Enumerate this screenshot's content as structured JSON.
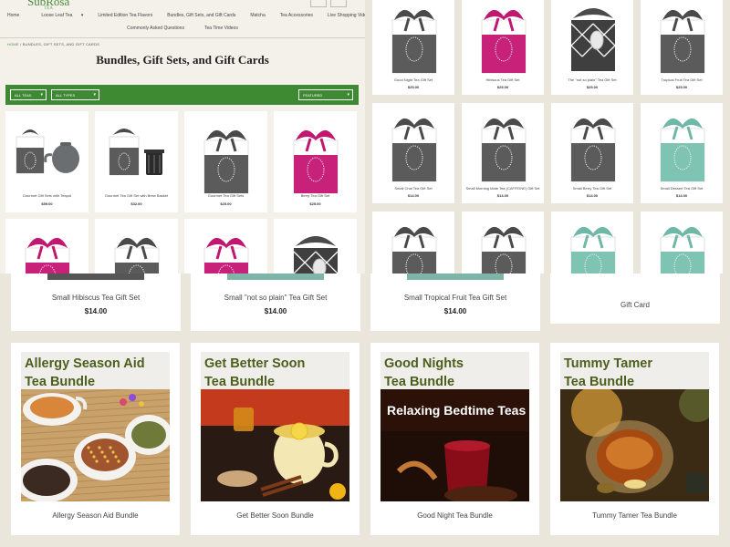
{
  "logo": {
    "text": "SubRosa",
    "sub": "TEA"
  },
  "nav": {
    "row1": [
      "Home",
      "Loose Leaf Tea",
      "Limited Edition Tea Flavors",
      "Bundles, Gift Sets, and Gift Cards",
      "Matcha",
      "Tea Accessories",
      "Live Shopping Videos"
    ],
    "row2": [
      "Commonly Asked Questions",
      "Tea Time Videos"
    ]
  },
  "breadcrumb": {
    "home": "HOME",
    "current": " / BUNDLES, GIFT SETS, AND GIFT CARDS"
  },
  "page_title": "Bundles, Gift Sets, and Gift Cards",
  "filters": {
    "teas": "ALL TEAS",
    "types": "ALL TYPES",
    "sort": "FEATURED"
  },
  "left_products": [
    {
      "name": "Gourmet Gift Sets with Teapot",
      "price": "$59.00",
      "art": "teapot"
    },
    {
      "name": "Gourmet Tea Gift Set with Brew Basket",
      "price": "$32.00",
      "art": "basket"
    },
    {
      "name": "Gourmet Tea Gift Sets",
      "price": "$25.00",
      "art": "gray"
    },
    {
      "name": "Berry Tea Gift Set",
      "price": "$25.00",
      "art": "pink"
    },
    {
      "name": "",
      "price": "",
      "art": "pink"
    },
    {
      "name": "",
      "price": "",
      "art": "gray"
    },
    {
      "name": "",
      "price": "",
      "art": "pink"
    },
    {
      "name": "",
      "price": "",
      "art": "pattern"
    }
  ],
  "right_products": [
    {
      "name": "Good Night Tea Gift Set",
      "price": "$25.00",
      "art": "gray"
    },
    {
      "name": "Hibiscus Tea Gift Set",
      "price": "$25.00",
      "art": "pink"
    },
    {
      "name": "The \"not so plain\" Tea Gift Set",
      "price": "$25.00",
      "art": "pattern"
    },
    {
      "name": "Tropical Fruit Tea Gift Set",
      "price": "$25.00",
      "art": "gray"
    },
    {
      "name": "Small Chai Tea Gift Set",
      "price": "$14.00",
      "art": "gray"
    },
    {
      "name": "Small Morning Mate Tea (CAFFEINE) Gift Set",
      "price": "$14.00",
      "art": "gray"
    },
    {
      "name": "Small Berry Tea Gift Set",
      "price": "$14.00",
      "art": "gray"
    },
    {
      "name": "Small Dessert Tea Gift Set",
      "price": "$14.00",
      "art": "teal"
    },
    {
      "name": "",
      "price": "",
      "art": "gray"
    },
    {
      "name": "",
      "price": "",
      "art": "gray"
    },
    {
      "name": "",
      "price": "",
      "art": "teal"
    },
    {
      "name": "",
      "price": "",
      "art": "teal"
    }
  ],
  "bottom_products": [
    {
      "name": "Small Hibiscus Tea Gift Set",
      "price": "$14.00",
      "bar": "#555555"
    },
    {
      "name": "Small \"not so plain\" Tea Gift Set",
      "price": "$14.00",
      "bar": "#7fb5a8"
    },
    {
      "name": "Small Tropical Fruit Tea Gift Set",
      "price": "$14.00",
      "bar": "#7fb5a8"
    },
    {
      "name": "Gift Card",
      "price": "",
      "bar": ""
    }
  ],
  "bundles": [
    {
      "line1": "Allergy Season Aid",
      "line2": "Tea Bundle",
      "overlay": "",
      "name": "Allergy Season Aid Bundle",
      "art": "allergy"
    },
    {
      "line1": "Get Better Soon",
      "line2": "Tea Bundle",
      "overlay": "",
      "name": "Get Better Soon Bundle",
      "art": "better"
    },
    {
      "line1": "Good Nights",
      "line2": "Tea Bundle",
      "overlay": "Relaxing Bedtime Teas",
      "name": "Good Night Tea Bundle",
      "art": "night"
    },
    {
      "line1": "Tummy Tamer",
      "line2": "Tea Bundle",
      "overlay": "",
      "name": "Tummy Tamer Tea Bundle",
      "art": "tummy"
    }
  ],
  "colors": {
    "brand_green": "#3d8a33",
    "title_green": "#4c5f1d",
    "pink": "#c8217a",
    "gray": "#5b5b5b",
    "teal": "#7fc3b3"
  }
}
